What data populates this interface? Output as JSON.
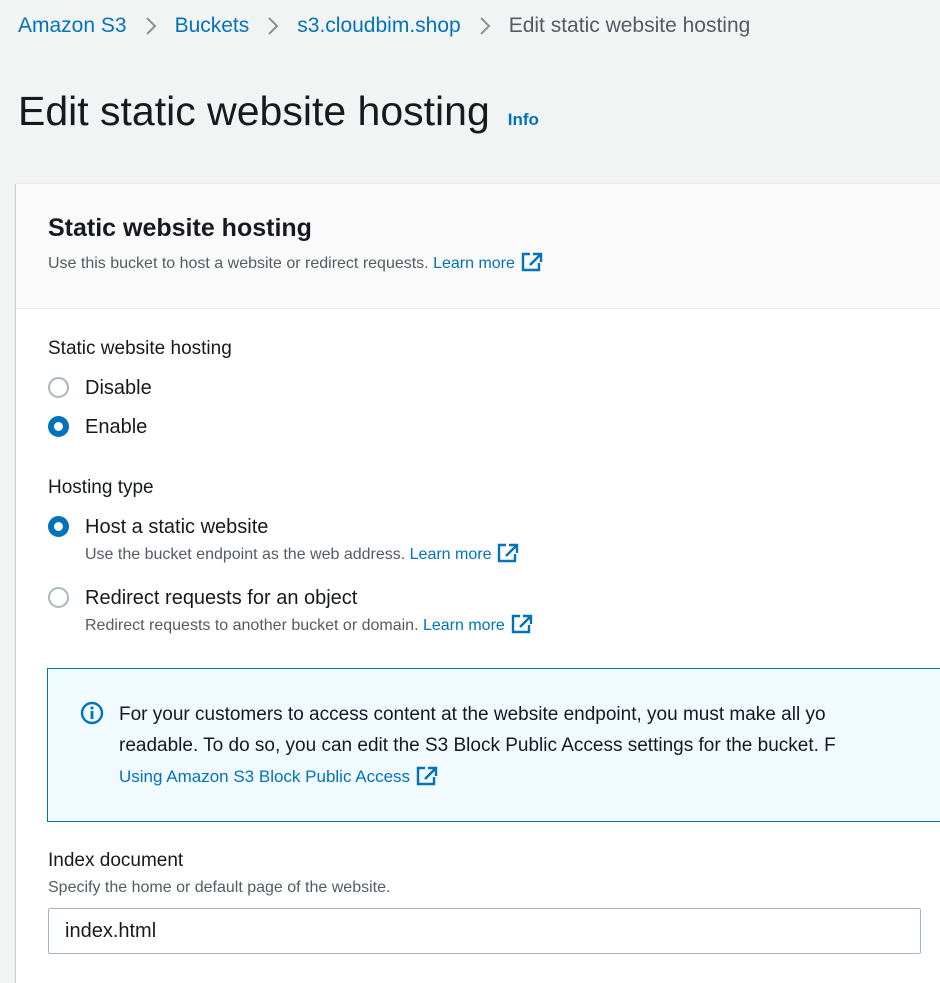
{
  "breadcrumb": {
    "items": [
      "Amazon S3",
      "Buckets",
      "s3.cloudbim.shop"
    ],
    "current": "Edit static website hosting"
  },
  "header": {
    "title": "Edit static website hosting",
    "info": "Info"
  },
  "section": {
    "title": "Static website hosting",
    "description": "Use this bucket to host a website or redirect requests.",
    "learn_more": "Learn more"
  },
  "hosting": {
    "label": "Static website hosting",
    "options": [
      "Disable",
      "Enable"
    ],
    "selected": "Enable"
  },
  "hosting_type": {
    "label": "Hosting type",
    "options": [
      {
        "label": "Host a static website",
        "description": "Use the bucket endpoint as the web address.",
        "link": "Learn more"
      },
      {
        "label": "Redirect requests for an object",
        "description": "Redirect requests to another bucket or domain.",
        "link": "Learn more"
      }
    ],
    "selected": "Host a static website"
  },
  "alert": {
    "line1": "For your customers to access content at the website endpoint, you must make all yo",
    "line2": "readable. To do so, you can edit the S3 Block Public Access settings for the bucket. F",
    "link": "Using Amazon S3 Block Public Access"
  },
  "index_document": {
    "label": "Index document",
    "description": "Specify the home or default page of the website.",
    "value": "index.html"
  },
  "colors": {
    "link": "#0073bb",
    "background": "#f2f3f3",
    "alert_background": "#f1faff"
  },
  "icons": [
    "chevron-right-icon",
    "external-link-icon",
    "info-icon"
  ]
}
